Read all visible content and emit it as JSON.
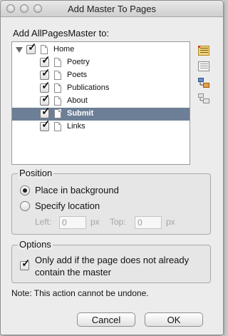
{
  "background": {
    "fragment": "ns"
  },
  "window": {
    "title": "Add Master To Pages"
  },
  "tree": {
    "heading": "Add AllPagesMaster to:",
    "items": [
      {
        "label": "Home",
        "checked": true,
        "level": 0,
        "expanded": true
      },
      {
        "label": "Poetry",
        "checked": true,
        "level": 1
      },
      {
        "label": "Poets",
        "checked": true,
        "level": 1
      },
      {
        "label": "Publications",
        "checked": true,
        "level": 1
      },
      {
        "label": "About",
        "checked": true,
        "level": 1
      },
      {
        "label": "Submit",
        "checked": true,
        "level": 1,
        "selected": true
      },
      {
        "label": "Links",
        "checked": true,
        "level": 1
      }
    ],
    "side_icons": [
      "check-all-icon",
      "uncheck-all-icon",
      "check-children-icon",
      "uncheck-children-icon"
    ]
  },
  "position": {
    "title": "Position",
    "options": [
      {
        "label": "Place in background",
        "selected": true
      },
      {
        "label": "Specify location",
        "selected": false
      }
    ],
    "left_label": "Left:",
    "left_value": "0",
    "left_unit": "px",
    "top_label": "Top:",
    "top_value": "0",
    "top_unit": "px"
  },
  "options": {
    "title": "Options",
    "only_add_line1": "Only add if the page does not already",
    "only_add_line2": "contain the master",
    "only_add_checked": true
  },
  "note": "Note: This action cannot be undone.",
  "buttons": {
    "cancel": "Cancel",
    "ok": "OK"
  },
  "colors": {
    "selection": "#6d7f96",
    "window_bg": "#ececec"
  }
}
